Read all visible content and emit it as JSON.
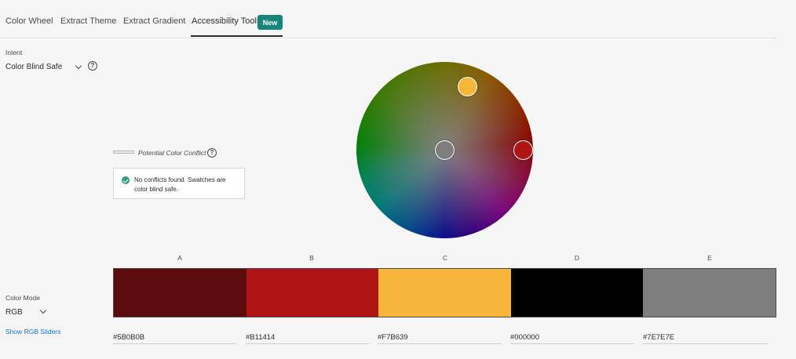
{
  "tabs": [
    {
      "label": "Color Wheel"
    },
    {
      "label": "Extract Theme"
    },
    {
      "label": "Extract Gradient"
    },
    {
      "label": "Accessibility Tools",
      "active": true,
      "badge": "New"
    }
  ],
  "intent": {
    "label": "Intent",
    "value": "Color Blind Safe",
    "help": "?"
  },
  "conflict": {
    "legend": "Potential Color Conflict",
    "help": "?",
    "message": "No conflicts found. Swatches are color blind safe."
  },
  "swatches": [
    {
      "label": "A",
      "hex": "#5B0B0B",
      "color": "#5B0B0B"
    },
    {
      "label": "B",
      "hex": "#B11414",
      "color": "#B11414"
    },
    {
      "label": "C",
      "hex": "#F7B639",
      "color": "#F7B639"
    },
    {
      "label": "D",
      "hex": "#000000",
      "color": "#000000"
    },
    {
      "label": "E",
      "hex": "#7E7E7E",
      "color": "#7E7E7E"
    }
  ],
  "color_mode": {
    "label": "Color Mode",
    "value": "RGB",
    "link": "Show RGB Sliders"
  },
  "icons": [
    "chevron-down-icon",
    "help-icon",
    "check-circle-icon"
  ]
}
